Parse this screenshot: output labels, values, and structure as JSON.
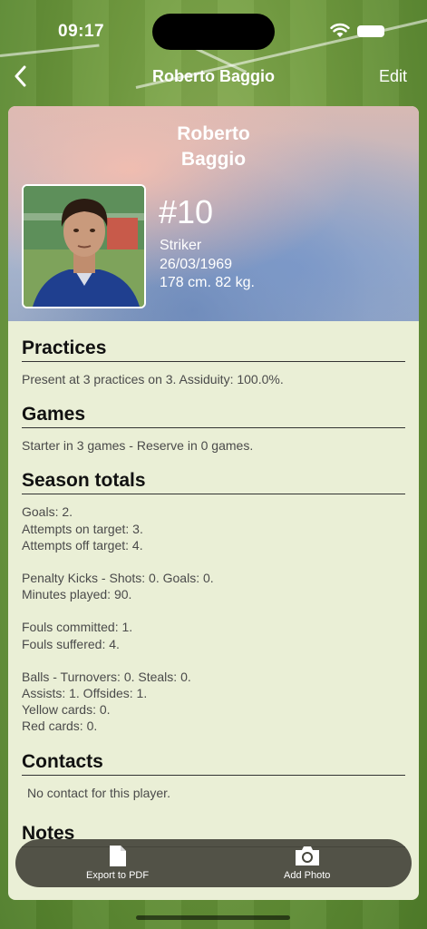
{
  "status_bar": {
    "time": "09:17"
  },
  "nav": {
    "title": "Roberto Baggio",
    "edit_label": "Edit"
  },
  "player": {
    "name_line1": "Roberto",
    "name_line2": "Baggio",
    "number": "#10",
    "role": "Striker",
    "birthdate": "26/03/1969",
    "physique": "178 cm. 82 kg."
  },
  "sections": {
    "practices": {
      "title": "Practices",
      "text": "Present at 3 practices on 3. Assiduity: 100.0%."
    },
    "games": {
      "title": "Games",
      "text": "Starter in 3 games - Reserve in 0 games."
    },
    "season_totals": {
      "title": "Season totals",
      "groups": [
        [
          "Goals: 2.",
          "Attempts on target: 3.",
          "Attempts off target: 4."
        ],
        [
          "Penalty Kicks - Shots: 0. Goals: 0.",
          "Minutes played: 90."
        ],
        [
          "Fouls committed: 1.",
          "Fouls suffered: 4."
        ],
        [
          "Balls - Turnovers: 0. Steals: 0.",
          "Assists: 1. Offsides: 1.",
          "Yellow cards: 0.",
          "Red cards: 0."
        ]
      ]
    },
    "contacts": {
      "title": "Contacts",
      "text": "No contact for this player."
    },
    "notes": {
      "title": "Notes"
    }
  },
  "toolbar": {
    "export_label": "Export to PDF",
    "export_icon": "document-icon",
    "photo_label": "Add Photo",
    "photo_icon": "camera-icon"
  }
}
